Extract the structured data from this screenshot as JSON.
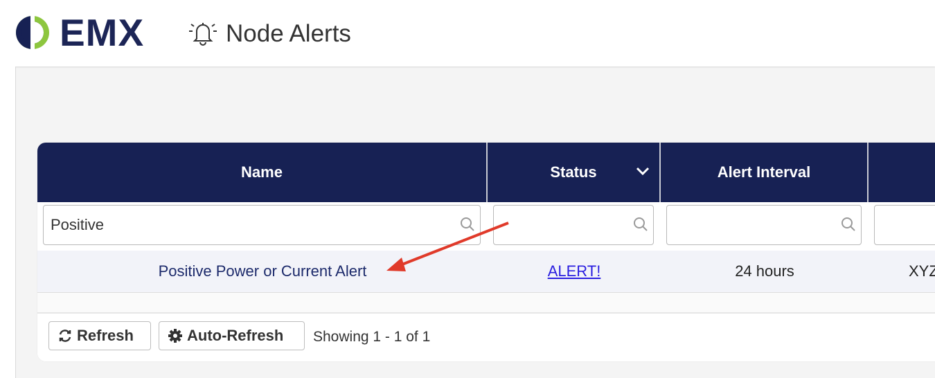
{
  "app": {
    "logo_text": "EMX",
    "page_title": "Node Alerts",
    "icons": [
      "emx-logo-icon",
      "bell-icon"
    ],
    "brand_color": "#172154",
    "accent_color": "#8dc63f"
  },
  "table": {
    "columns": [
      {
        "label": "Name"
      },
      {
        "label": "Status"
      },
      {
        "label": "Alert Interval"
      },
      {
        "label": ""
      }
    ],
    "filters": [
      {
        "value": "Positive",
        "placeholder": ""
      },
      {
        "value": "",
        "placeholder": ""
      },
      {
        "value": "",
        "placeholder": ""
      },
      {
        "value": "",
        "placeholder": ""
      }
    ],
    "rows": [
      {
        "name": "Positive Power or Current Alert",
        "status": "ALERT!",
        "interval": "24 hours",
        "extra": "XYZ"
      }
    ]
  },
  "footer": {
    "refresh_label": "Refresh",
    "auto_refresh_label": "Auto-Refresh",
    "showing_text": "Showing 1 - 1 of 1"
  },
  "annotation": {
    "arrow_color": "#e03a2a"
  }
}
